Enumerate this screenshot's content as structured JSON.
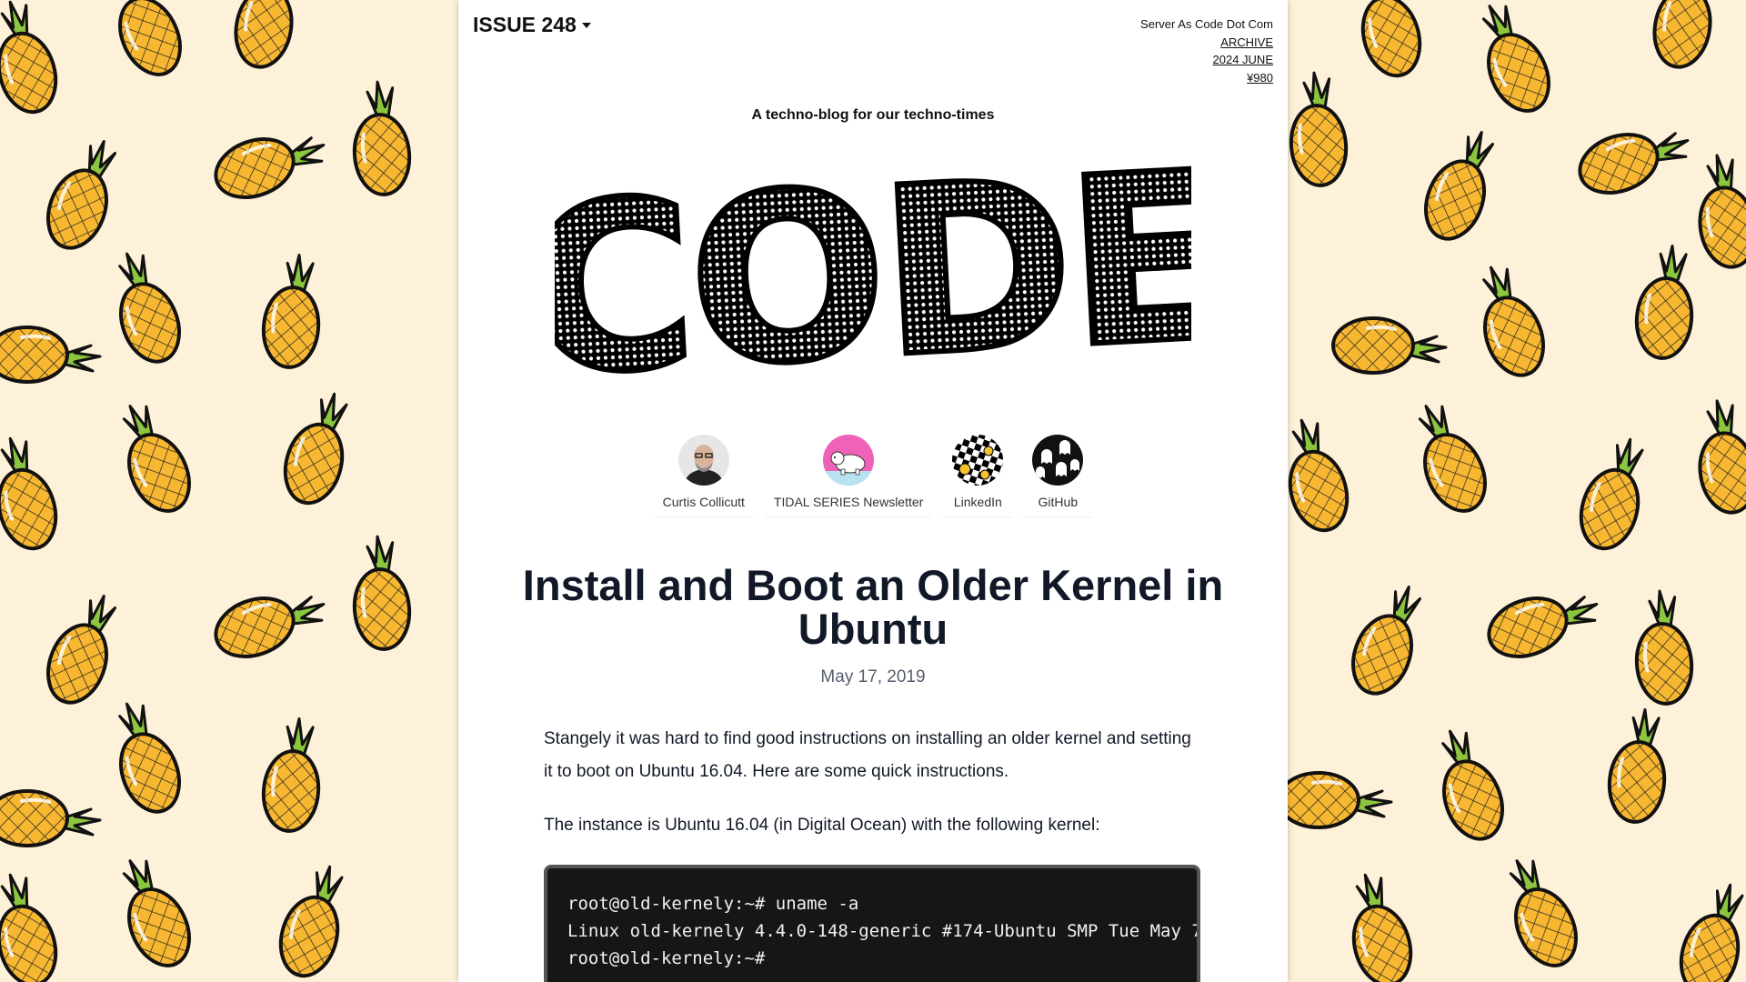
{
  "header": {
    "issue_label": "ISSUE 248",
    "site_name": "Server As Code Dot Com",
    "archive_link": "ARCHIVE",
    "edition_link": "2024 JUNE",
    "price_link": "¥980"
  },
  "tagline": "A techno-blog for our techno-times",
  "logo_text": "CODE",
  "profiles": [
    {
      "label": "Curtis Collicutt",
      "icon": "avatar-photo"
    },
    {
      "label": "TIDAL SERIES Newsletter",
      "icon": "polar-bear-avatar"
    },
    {
      "label": "LinkedIn",
      "icon": "checkerboard-smiley-avatar"
    },
    {
      "label": "GitHub",
      "icon": "ghost-pattern-avatar"
    }
  ],
  "article": {
    "title": "Install and Boot an Older Kernel in Ubuntu",
    "date": "May 17, 2019",
    "paragraph_1": "Stangely it was hard to find good instructions on installing an older kernel and setting it to boot on Ubuntu 16.04. Here are some quick instructions.",
    "paragraph_2": "The instance is Ubuntu 16.04 (in Digital Ocean) with the following kernel:",
    "code_lines": [
      "root@old-kernely:~# uname -a",
      "Linux old-kernely 4.4.0-148-generic #174-Ubuntu SMP Tue May 7",
      "root@old-kernely:~#"
    ]
  },
  "colors": {
    "background": "#fdf1d9",
    "pineapple_body": "#f7b731",
    "pineapple_leaves": "#8cc63f",
    "title": "#111827",
    "code_background": "#161616"
  }
}
